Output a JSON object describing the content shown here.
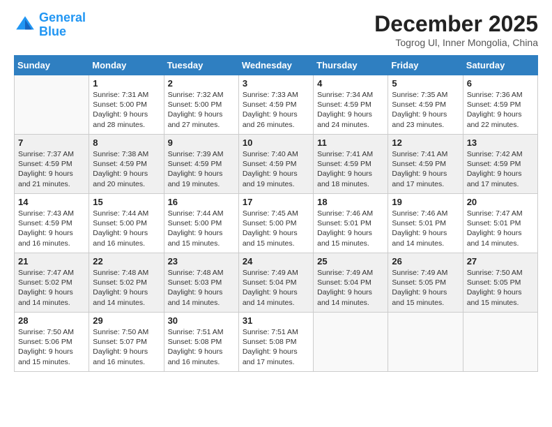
{
  "header": {
    "logo_line1": "General",
    "logo_line2": "Blue",
    "month_title": "December 2025",
    "location": "Togrog Ul, Inner Mongolia, China"
  },
  "days_of_week": [
    "Sunday",
    "Monday",
    "Tuesday",
    "Wednesday",
    "Thursday",
    "Friday",
    "Saturday"
  ],
  "weeks": [
    [
      {
        "day": "",
        "info": []
      },
      {
        "day": "1",
        "info": [
          "Sunrise: 7:31 AM",
          "Sunset: 5:00 PM",
          "Daylight: 9 hours",
          "and 28 minutes."
        ]
      },
      {
        "day": "2",
        "info": [
          "Sunrise: 7:32 AM",
          "Sunset: 5:00 PM",
          "Daylight: 9 hours",
          "and 27 minutes."
        ]
      },
      {
        "day": "3",
        "info": [
          "Sunrise: 7:33 AM",
          "Sunset: 4:59 PM",
          "Daylight: 9 hours",
          "and 26 minutes."
        ]
      },
      {
        "day": "4",
        "info": [
          "Sunrise: 7:34 AM",
          "Sunset: 4:59 PM",
          "Daylight: 9 hours",
          "and 24 minutes."
        ]
      },
      {
        "day": "5",
        "info": [
          "Sunrise: 7:35 AM",
          "Sunset: 4:59 PM",
          "Daylight: 9 hours",
          "and 23 minutes."
        ]
      },
      {
        "day": "6",
        "info": [
          "Sunrise: 7:36 AM",
          "Sunset: 4:59 PM",
          "Daylight: 9 hours",
          "and 22 minutes."
        ]
      }
    ],
    [
      {
        "day": "7",
        "info": [
          "Sunrise: 7:37 AM",
          "Sunset: 4:59 PM",
          "Daylight: 9 hours",
          "and 21 minutes."
        ]
      },
      {
        "day": "8",
        "info": [
          "Sunrise: 7:38 AM",
          "Sunset: 4:59 PM",
          "Daylight: 9 hours",
          "and 20 minutes."
        ]
      },
      {
        "day": "9",
        "info": [
          "Sunrise: 7:39 AM",
          "Sunset: 4:59 PM",
          "Daylight: 9 hours",
          "and 19 minutes."
        ]
      },
      {
        "day": "10",
        "info": [
          "Sunrise: 7:40 AM",
          "Sunset: 4:59 PM",
          "Daylight: 9 hours",
          "and 19 minutes."
        ]
      },
      {
        "day": "11",
        "info": [
          "Sunrise: 7:41 AM",
          "Sunset: 4:59 PM",
          "Daylight: 9 hours",
          "and 18 minutes."
        ]
      },
      {
        "day": "12",
        "info": [
          "Sunrise: 7:41 AM",
          "Sunset: 4:59 PM",
          "Daylight: 9 hours",
          "and 17 minutes."
        ]
      },
      {
        "day": "13",
        "info": [
          "Sunrise: 7:42 AM",
          "Sunset: 4:59 PM",
          "Daylight: 9 hours",
          "and 17 minutes."
        ]
      }
    ],
    [
      {
        "day": "14",
        "info": [
          "Sunrise: 7:43 AM",
          "Sunset: 4:59 PM",
          "Daylight: 9 hours",
          "and 16 minutes."
        ]
      },
      {
        "day": "15",
        "info": [
          "Sunrise: 7:44 AM",
          "Sunset: 5:00 PM",
          "Daylight: 9 hours",
          "and 16 minutes."
        ]
      },
      {
        "day": "16",
        "info": [
          "Sunrise: 7:44 AM",
          "Sunset: 5:00 PM",
          "Daylight: 9 hours",
          "and 15 minutes."
        ]
      },
      {
        "day": "17",
        "info": [
          "Sunrise: 7:45 AM",
          "Sunset: 5:00 PM",
          "Daylight: 9 hours",
          "and 15 minutes."
        ]
      },
      {
        "day": "18",
        "info": [
          "Sunrise: 7:46 AM",
          "Sunset: 5:01 PM",
          "Daylight: 9 hours",
          "and 15 minutes."
        ]
      },
      {
        "day": "19",
        "info": [
          "Sunrise: 7:46 AM",
          "Sunset: 5:01 PM",
          "Daylight: 9 hours",
          "and 14 minutes."
        ]
      },
      {
        "day": "20",
        "info": [
          "Sunrise: 7:47 AM",
          "Sunset: 5:01 PM",
          "Daylight: 9 hours",
          "and 14 minutes."
        ]
      }
    ],
    [
      {
        "day": "21",
        "info": [
          "Sunrise: 7:47 AM",
          "Sunset: 5:02 PM",
          "Daylight: 9 hours",
          "and 14 minutes."
        ]
      },
      {
        "day": "22",
        "info": [
          "Sunrise: 7:48 AM",
          "Sunset: 5:02 PM",
          "Daylight: 9 hours",
          "and 14 minutes."
        ]
      },
      {
        "day": "23",
        "info": [
          "Sunrise: 7:48 AM",
          "Sunset: 5:03 PM",
          "Daylight: 9 hours",
          "and 14 minutes."
        ]
      },
      {
        "day": "24",
        "info": [
          "Sunrise: 7:49 AM",
          "Sunset: 5:04 PM",
          "Daylight: 9 hours",
          "and 14 minutes."
        ]
      },
      {
        "day": "25",
        "info": [
          "Sunrise: 7:49 AM",
          "Sunset: 5:04 PM",
          "Daylight: 9 hours",
          "and 14 minutes."
        ]
      },
      {
        "day": "26",
        "info": [
          "Sunrise: 7:49 AM",
          "Sunset: 5:05 PM",
          "Daylight: 9 hours",
          "and 15 minutes."
        ]
      },
      {
        "day": "27",
        "info": [
          "Sunrise: 7:50 AM",
          "Sunset: 5:05 PM",
          "Daylight: 9 hours",
          "and 15 minutes."
        ]
      }
    ],
    [
      {
        "day": "28",
        "info": [
          "Sunrise: 7:50 AM",
          "Sunset: 5:06 PM",
          "Daylight: 9 hours",
          "and 15 minutes."
        ]
      },
      {
        "day": "29",
        "info": [
          "Sunrise: 7:50 AM",
          "Sunset: 5:07 PM",
          "Daylight: 9 hours",
          "and 16 minutes."
        ]
      },
      {
        "day": "30",
        "info": [
          "Sunrise: 7:51 AM",
          "Sunset: 5:08 PM",
          "Daylight: 9 hours",
          "and 16 minutes."
        ]
      },
      {
        "day": "31",
        "info": [
          "Sunrise: 7:51 AM",
          "Sunset: 5:08 PM",
          "Daylight: 9 hours",
          "and 17 minutes."
        ]
      },
      {
        "day": "",
        "info": []
      },
      {
        "day": "",
        "info": []
      },
      {
        "day": "",
        "info": []
      }
    ]
  ]
}
